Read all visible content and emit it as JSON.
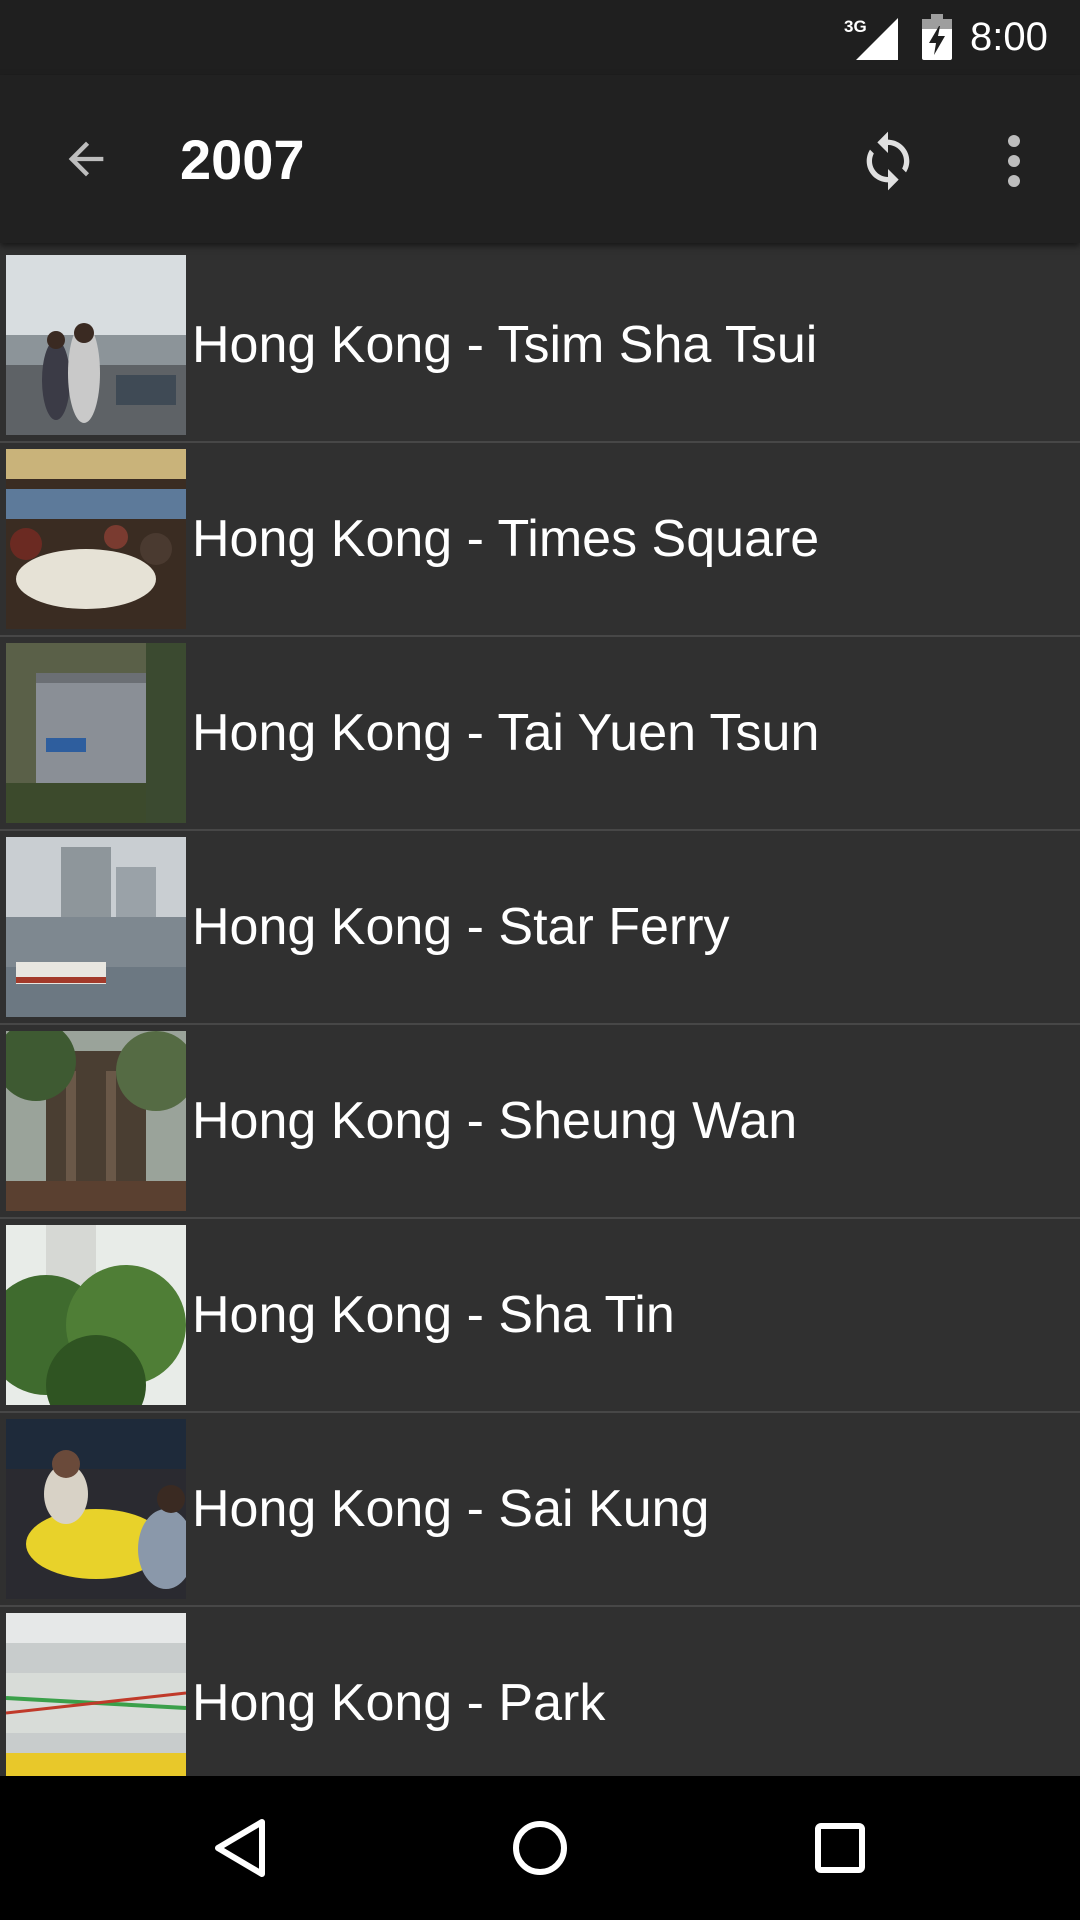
{
  "status_bar": {
    "network": "3G",
    "time": "8:00"
  },
  "app_bar": {
    "title": "2007",
    "back_icon": "arrow-back-icon",
    "sync_icon": "sync-icon",
    "more_icon": "more-vert-icon"
  },
  "albums": [
    {
      "label": "Hong Kong - Tsim Sha Tsui"
    },
    {
      "label": "Hong Kong - Times Square"
    },
    {
      "label": "Hong Kong - Tai Yuen Tsun"
    },
    {
      "label": "Hong Kong - Star Ferry"
    },
    {
      "label": "Hong Kong - Sheung Wan"
    },
    {
      "label": "Hong Kong - Sha Tin"
    },
    {
      "label": "Hong Kong - Sai Kung"
    },
    {
      "label": "Hong Kong - Park"
    }
  ],
  "nav_bar": {
    "back_icon": "nav-back-icon",
    "home_icon": "nav-home-icon",
    "recents_icon": "nav-recents-icon"
  },
  "colors": {
    "status_bar": "#1f1f1f",
    "app_bar": "#212121",
    "list_background": "#303030",
    "divider": "#474747",
    "text": "#ffffff",
    "nav_bar": "#000000"
  }
}
